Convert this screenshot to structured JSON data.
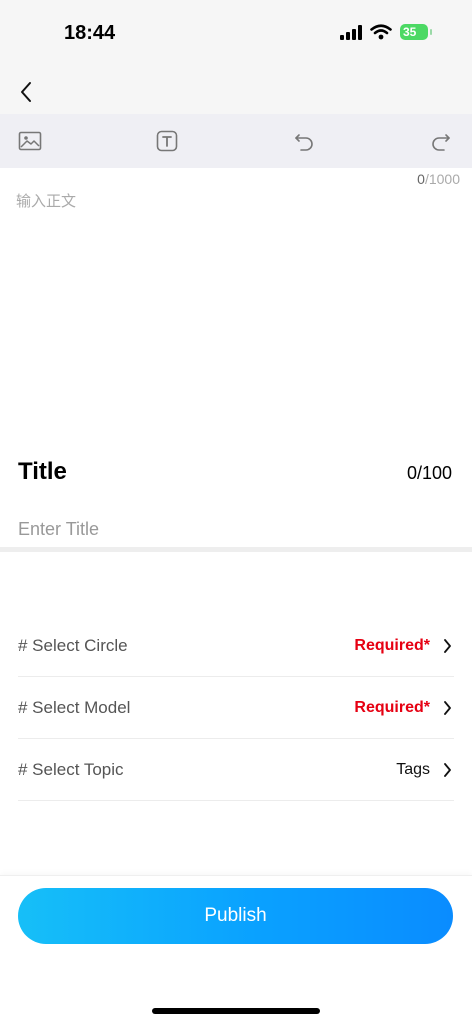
{
  "status_bar": {
    "time": "18:44",
    "battery": "35"
  },
  "editor": {
    "char_count_current": "0",
    "char_count_max": "/1000",
    "body_placeholder": "输入正文"
  },
  "title_section": {
    "label": "Title",
    "count": "0/100",
    "placeholder": "Enter Title"
  },
  "selects": [
    {
      "label": "# Select Circle",
      "value": "Required*"
    },
    {
      "label": "# Select Model",
      "value": "Required*"
    },
    {
      "label": "# Select Topic",
      "value": "Tags"
    }
  ],
  "publish": {
    "label": "Publish"
  },
  "icons": {
    "back": "chevron-left-icon",
    "image": "image-icon",
    "text": "text-format-icon",
    "undo": "undo-icon",
    "redo": "redo-icon",
    "row_chevron": "chevron-right-icon"
  },
  "colors": {
    "required": "#e60012",
    "accent": "#0aa1ff",
    "battery": "#4cd964"
  }
}
